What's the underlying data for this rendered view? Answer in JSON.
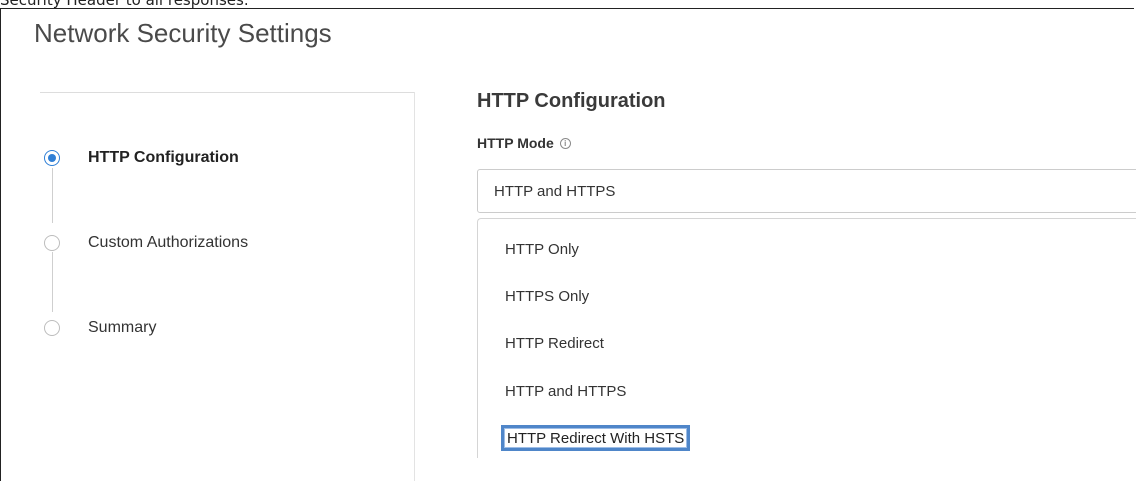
{
  "doc_snippet": "Security Header to all responses.",
  "page": {
    "title": "Network Security Settings"
  },
  "stepper": {
    "steps": [
      {
        "label": "HTTP Configuration",
        "state": "active"
      },
      {
        "label": "Custom Authorizations",
        "state": "inactive"
      },
      {
        "label": "Summary",
        "state": "inactive"
      }
    ]
  },
  "form": {
    "section_title": "HTTP Configuration",
    "http_mode": {
      "label": "HTTP Mode",
      "info_icon": "info-icon",
      "selected_value": "HTTP and HTTPS",
      "options": [
        "HTTP Only",
        "HTTPS Only",
        "HTTP Redirect",
        "HTTP and HTTPS",
        "HTTP Redirect With HSTS"
      ],
      "focused_option": "HTTP Redirect With HSTS"
    }
  },
  "colors": {
    "accent": "#2f7fd6",
    "focus_outline": "#4f86c9",
    "title_text": "#4a4a4a"
  }
}
